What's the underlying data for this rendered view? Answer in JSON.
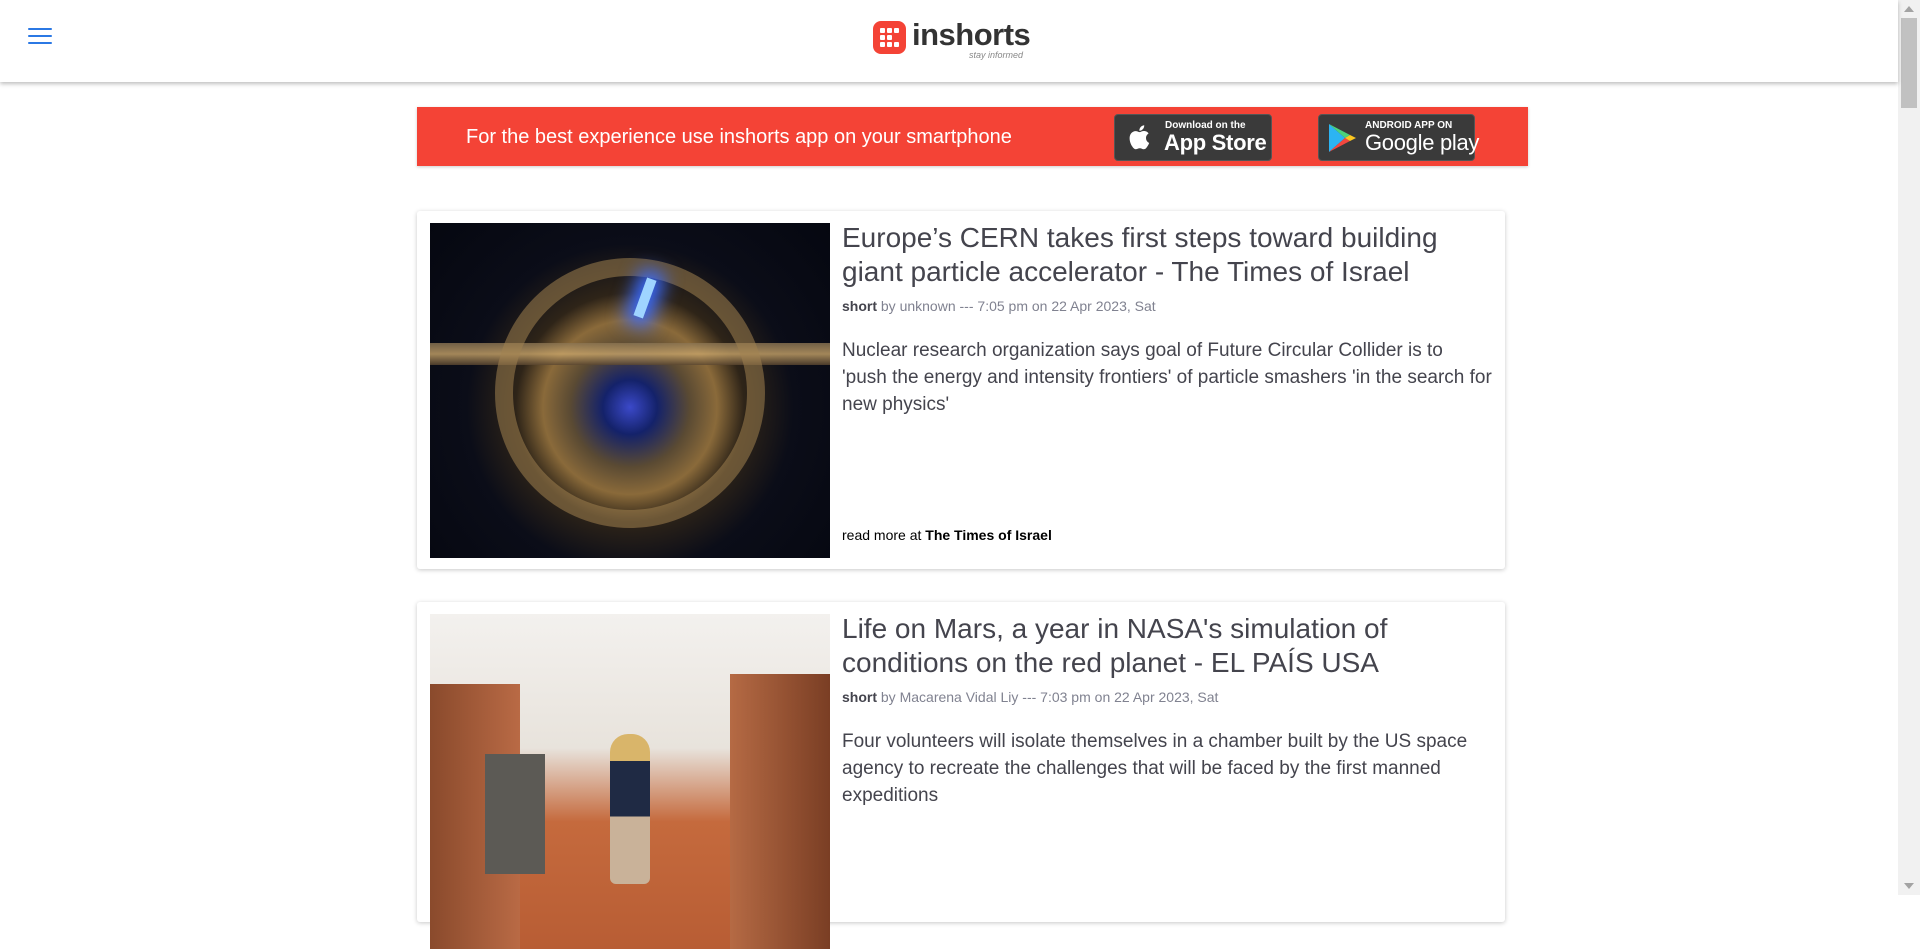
{
  "header": {
    "brand": "inshorts",
    "tagline": "stay informed"
  },
  "banner": {
    "text": "For the best experience use inshorts app on your smartphone",
    "app_store": {
      "small": "Download on the",
      "big": "App Store"
    },
    "google_play": {
      "small": "ANDROID APP ON",
      "big": "Google play"
    }
  },
  "articles": [
    {
      "title": "Europe’s CERN takes first steps toward building giant particle accelerator - The Times of Israel",
      "label": "short",
      "author_prefix": "by",
      "author": "unknown",
      "separator": "---",
      "time": "7:05 pm",
      "date_prefix": "on",
      "date": "22 Apr 2023, Sat",
      "body": "Nuclear research organization says goal of Future Circular Collider is to 'push the energy and intensity frontiers' of particle smashers 'in the search for new physics'",
      "read_more_prefix": "read more at",
      "source": "The Times of Israel"
    },
    {
      "title": "Life on Mars, a year in NASA's simulation of conditions on the red planet - EL PAÍS USA",
      "label": "short",
      "author_prefix": "by",
      "author": "Macarena Vidal Liy",
      "separator": "---",
      "time": "7:03 pm",
      "date_prefix": "on",
      "date": "22 Apr 2023, Sat",
      "body": "Four volunteers will isolate themselves in a chamber built by the US space agency to recreate the challenges that will be faced by the first manned expeditions"
    }
  ],
  "icons": {
    "menu": "hamburger-icon",
    "apple": "apple-icon",
    "google_play": "google-play-icon"
  },
  "colors": {
    "brand_red": "#f44336",
    "menu_blue": "#2b78e4",
    "text": "#44444d",
    "meta": "#808290"
  }
}
